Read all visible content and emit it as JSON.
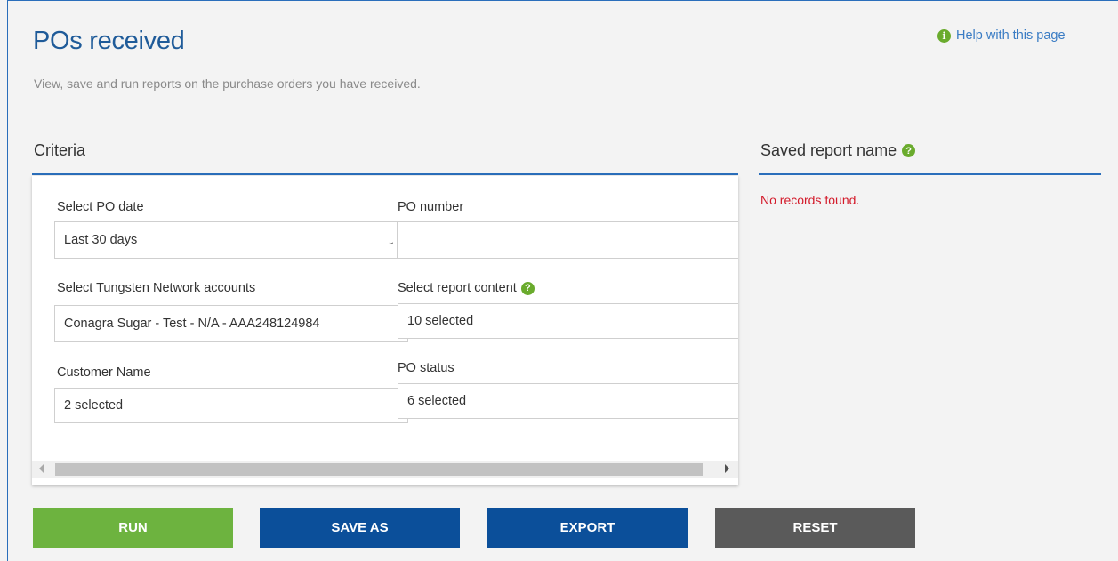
{
  "header": {
    "title": "POs received",
    "subtitle": "View, save and run reports on the purchase orders you have received.",
    "help_link": "Help with this page"
  },
  "criteria": {
    "heading": "Criteria",
    "po_date": {
      "label": "Select PO date",
      "value": "Last 30 days"
    },
    "po_number": {
      "label": "PO number",
      "value": ""
    },
    "accounts": {
      "label": "Select Tungsten Network accounts",
      "value": "Conagra Sugar - Test - N/A - AAA248124984"
    },
    "report_content": {
      "label": "Select report content",
      "value": "10 selected"
    },
    "customer_name": {
      "label": "Customer Name",
      "value": "2 selected"
    },
    "po_status": {
      "label": "PO status",
      "value": "6 selected"
    }
  },
  "saved_reports": {
    "heading": "Saved report name",
    "empty_message": "No records found."
  },
  "actions": {
    "run": "RUN",
    "save_as": "SAVE AS",
    "export": "EXPORT",
    "reset": "RESET"
  },
  "icons": {
    "help": "info-icon",
    "question": "question-icon"
  },
  "colors": {
    "title": "#1f5b99",
    "accent": "#2a6ebb",
    "run": "#6db33f",
    "primary": "#0b4f9a",
    "reset": "#5a5a5a",
    "error": "#d31a2a",
    "help_icon": "#6aab2d"
  }
}
